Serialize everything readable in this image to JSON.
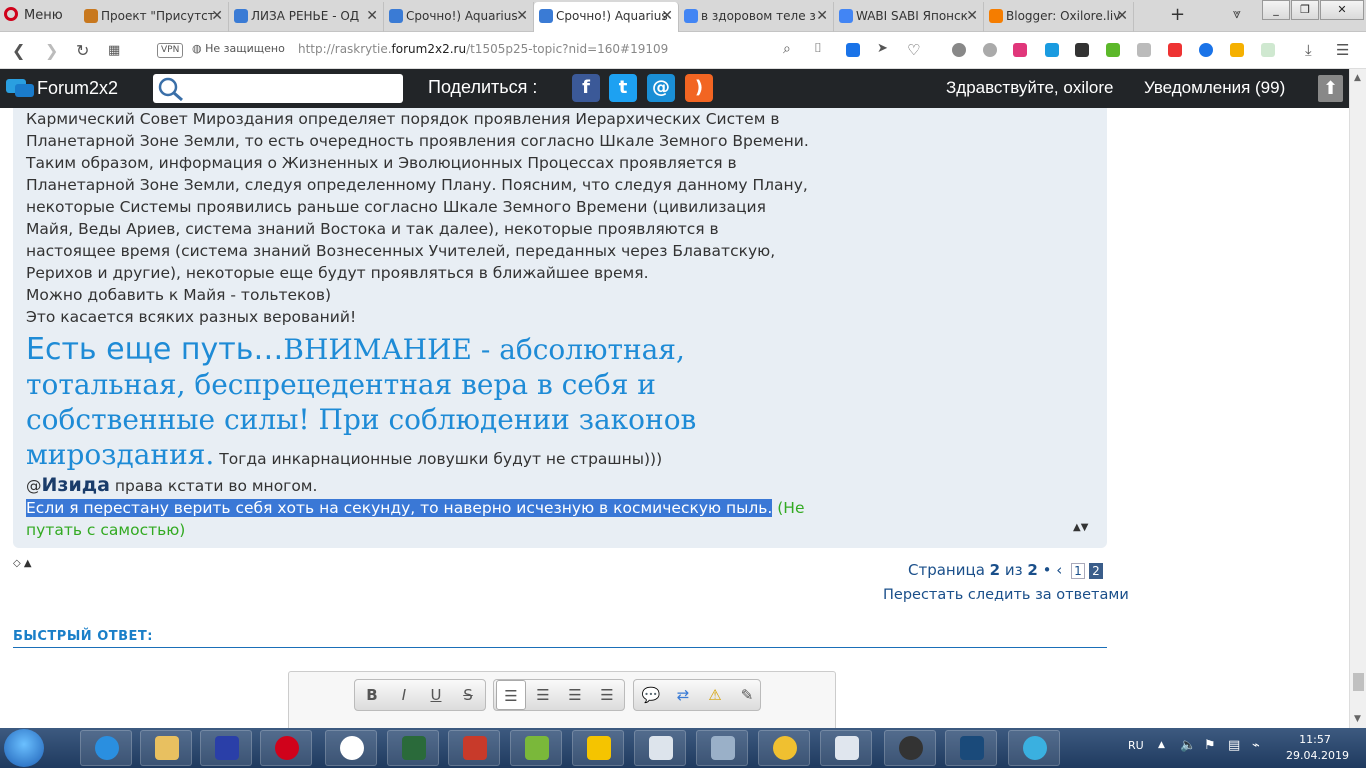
{
  "browser": {
    "menu_label": "Меню",
    "tabs": [
      {
        "title": "Проект \"Присутст",
        "color": "#c8781e"
      },
      {
        "title": "ЛИЗА РЕНЬЕ - ОД",
        "color": "#3a7bd5"
      },
      {
        "title": "Срочно!) Aquarius",
        "color": "#3a7bd5"
      },
      {
        "title": "Срочно!) Aquarius",
        "color": "#3a7bd5",
        "active": true
      },
      {
        "title": "в здоровом теле з",
        "color": "#4285f4"
      },
      {
        "title": "WABI SABI Японск",
        "color": "#4285f4"
      },
      {
        "title": "Blogger: Oxilore.liv",
        "color": "#f57d00"
      }
    ],
    "new_tab": "+",
    "vpn_label": "VPN",
    "security_label": "Не защищено",
    "url_prefix": "http://raskrytie.",
    "url_domain": "forum2x2.ru",
    "url_path": "/t1505p25-topic?nid=160#19109"
  },
  "forum_header": {
    "site_name": "Forum2x2",
    "share_label": "Поделиться :",
    "greeting": "Здравствуйте, oxilore",
    "notifications": "Уведомления  (99)"
  },
  "post": {
    "lines": [
      "Кармический Совет Мироздания определяет порядок проявления Иерархических Систем в",
      "Планетарной Зоне Земли, то есть очередность проявления согласно Шкале Земного Времени.",
      "Таким образом, информация о Жизненных и Эволюционных Процессах проявляется в",
      "Планетарной Зоне Земли, следуя определенному Плану. Поясним, что следуя данному Плану,",
      "некоторые Системы проявились раньше согласно Шкале Земного Времени (цивилизация",
      "Майя, Веды Ариев, система знаний Востока и так далее), некоторые проявляются в",
      "настоящее время (система знаний Вознесенных Учителей, переданных через Блаватскую,",
      "Рерихов и другие), некоторые еще будут проявляться в ближайшее время.",
      "Можно добавить к Майя - тольтеков)",
      "Это касается всяких разных верований!"
    ],
    "big_prefix": "Есть еще путь…",
    "big_serif": "ВНИМАНИЕ - абсолютная, тотальная, беспрецедентная вера в себя и собственные силы! При соблюдении законов мироздания.",
    "small_tail": " Тогда инкарнационные ловушки будут не страшны)))",
    "mention_at": "@",
    "mention_name": "Изида",
    "mention_tail": " права кстати во многом.",
    "selected_text": "Если я перестану верить себя хоть на секунду, то наверно исчезную в космическую пыль.",
    "green_text": " (Не путать с самостью)"
  },
  "pagination": {
    "prefix": "Страница ",
    "current": "2",
    "of": " из ",
    "total": "2",
    "pages": [
      "1",
      "2"
    ],
    "unwatch": "Перестать следить за ответами"
  },
  "quick_reply": {
    "title": "БЫСТРЫЙ ОТВЕТ:"
  },
  "taskbar": {
    "lang": "RU",
    "time": "11:57",
    "date": "29.04.2019"
  }
}
